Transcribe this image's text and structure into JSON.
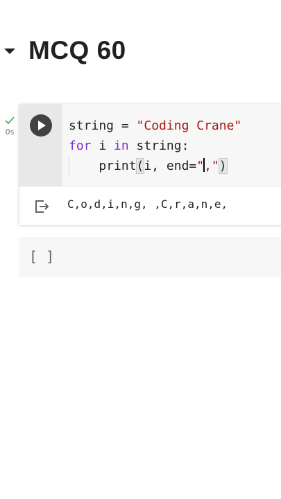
{
  "section": {
    "title": "MCQ 60"
  },
  "cell1": {
    "exec_time": "0s",
    "code": {
      "line1": {
        "var": "string = ",
        "str": "\"Coding Crane\""
      },
      "line2": {
        "kw_for": "for",
        "mid1": " i ",
        "kw_in": "in",
        "mid2": " string:"
      },
      "line3": {
        "indent": "    ",
        "fn": "print",
        "open_paren": "(",
        "args": "i, end=",
        "str_open": "\"",
        "str_rest": ",\"",
        "close_paren": ")"
      }
    },
    "output": "C,o,d,i,n,g, ,C,r,a,n,e,"
  },
  "cell2": {
    "placeholder": "[ ]"
  },
  "colors": {
    "keyword": "#7b30d0",
    "string": "#a31515",
    "check": "#34a853",
    "run_button": "#424242"
  }
}
